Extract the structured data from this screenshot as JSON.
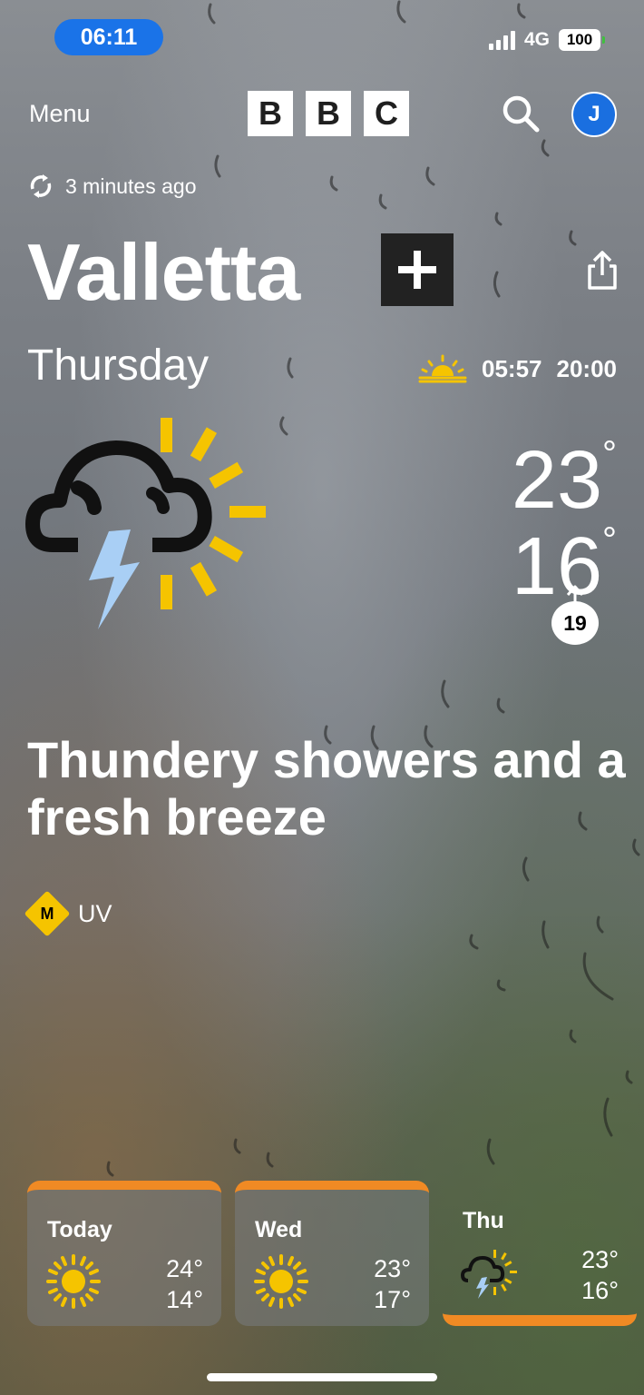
{
  "status_bar": {
    "time": "06:11",
    "network": "4G",
    "battery": "100"
  },
  "header": {
    "menu_label": "Menu",
    "logo_letters": [
      "B",
      "B",
      "C"
    ],
    "avatar_initial": "J"
  },
  "updated_text": "3 minutes ago",
  "location": {
    "city": "Valletta"
  },
  "today": {
    "day": "Thursday",
    "sunrise": "05:57",
    "sunset": "20:00",
    "high": "23",
    "low": "16",
    "degree_symbol": "°",
    "wind_speed": "19",
    "summary": "Thundery showers and a fresh breeze",
    "uv_level": "M",
    "uv_label": "UV",
    "icon": "thundery-showers-icon"
  },
  "forecast": [
    {
      "day": "Today",
      "high": "24°",
      "low": "14°",
      "icon": "sunny-icon"
    },
    {
      "day": "Wed",
      "high": "23°",
      "low": "17°",
      "icon": "sunny-icon"
    },
    {
      "day": "Thu",
      "high": "23°",
      "low": "16°",
      "icon": "thundery-showers-icon"
    }
  ],
  "colors": {
    "accent": "#f08a24",
    "sun": "#f5c400",
    "avatar": "#1a6fe0",
    "lightning": "#a9cff5"
  }
}
